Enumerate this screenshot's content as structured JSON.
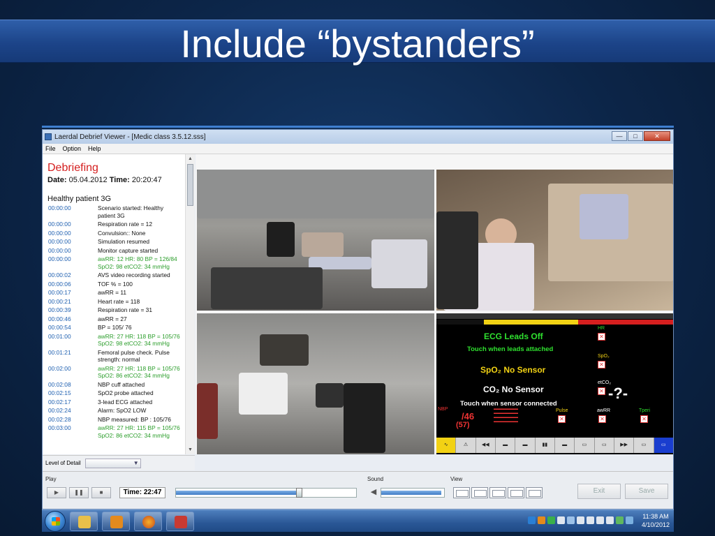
{
  "slide": {
    "title": "Include “bystanders”"
  },
  "window": {
    "title": "Laerdal Debrief Viewer - [Medic class 3.5.12.sss]",
    "controls": {
      "minimize": "—",
      "maximize": "□",
      "close": "✕"
    },
    "menu": [
      "File",
      "Option",
      "Help"
    ]
  },
  "debrief": {
    "title": "Debriefing",
    "date_label": "Date:",
    "date_value": "05.04.2012",
    "time_label": "Time:",
    "time_value": "20:20:47",
    "scenario": "Healthy patient 3G",
    "events": [
      {
        "time": "00:00:00",
        "text": "Scenario started: Healthy patient 3G"
      },
      {
        "time": "00:00:00",
        "text": "Respiration rate = 12"
      },
      {
        "time": "00:00:00",
        "text": "Convulsion:: None"
      },
      {
        "time": "00:00:00",
        "text": "Simulation resumed"
      },
      {
        "time": "00:00:00",
        "text": "Monitor capture started"
      },
      {
        "time": "00:00:00",
        "text": "awRR: 12 HR: 80 BP = 126/84 SpO2: 98 etCO2: 34 mmHg",
        "vitals": true
      },
      {
        "time": "00:00:02",
        "text": "AVS video recording started"
      },
      {
        "time": "00:00:06",
        "text": "TOF % = 100"
      },
      {
        "time": "00:00:17",
        "text": "awRR = 11"
      },
      {
        "time": "00:00:21",
        "text": "Heart rate = 118"
      },
      {
        "time": "00:00:39",
        "text": "Respiration rate = 31"
      },
      {
        "time": "00:00:46",
        "text": "awRR = 27"
      },
      {
        "time": "00:00:54",
        "text": "BP = 105/ 76"
      },
      {
        "time": "00:01:00",
        "text": "awRR: 27 HR: 118 BP = 105/76 SpO2: 98 etCO2: 34 mmHg",
        "vitals": true
      },
      {
        "time": "00:01:21",
        "text": "Femoral pulse check. Pulse strength: normal"
      },
      {
        "time": "00:02:00",
        "text": "awRR: 27 HR: 118 BP = 105/76 SpO2: 86 etCO2: 34 mmHg",
        "vitals": true
      },
      {
        "time": "00:02:08",
        "text": "NBP cuff attached"
      },
      {
        "time": "00:02:15",
        "text": "SpO2 probe attached"
      },
      {
        "time": "00:02:17",
        "text": "3-lead ECG attached"
      },
      {
        "time": "00:02:24",
        "text": "Alarm: SpO2 LOW"
      },
      {
        "time": "00:02:28",
        "text": "NBP measured: BP : 105/76"
      },
      {
        "time": "00:03:00",
        "text": "awRR: 27 HR: 115 BP = 105/76 SpO2: 86 etCO2: 34 mmHg",
        "vitals": true
      }
    ],
    "level_of_detail_label": "Level of Detail"
  },
  "monitor": {
    "ecg": "ECG Leads Off",
    "touch_leads": "Touch when leads attached",
    "spo2": "SpO₂ No Sensor",
    "co2": "CO₂ No Sensor",
    "touch_sensor": "Touch when sensor connected",
    "hr_label": "HR",
    "spo2_label": "SpO₂",
    "etco2_label": "etCO₂",
    "qmark": "-?-",
    "nbp_label": "NBP",
    "nbp_value": "/46",
    "nbp_mean": "(57)",
    "pulse_label": "Pulse",
    "awrr_label": "awRR",
    "tperi_label": "Tperi"
  },
  "controls": {
    "play_label": "Play",
    "time_label": "Time: 22:47",
    "sound_label": "Sound",
    "view_label": "View",
    "exit_label": "Exit",
    "save_label": "Save"
  },
  "taskbar": {
    "clock_time": "11:38 AM",
    "clock_date": "4/10/2012"
  }
}
